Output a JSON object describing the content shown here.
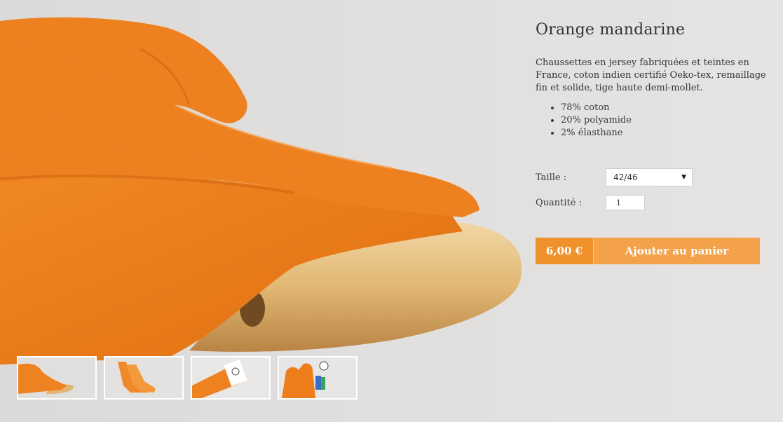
{
  "product": {
    "title": "Orange mandarine",
    "description": "Chaussettes en jersey fabriquées et teintes en France, coton indien certifié Oeko-tex,  remaillage  fin et solide, tige haute demi-mollet.",
    "composition": [
      "78% coton",
      "20% polyamide",
      "2% élasthane"
    ]
  },
  "options": {
    "size_label": "Taille  :",
    "size_value": "42/46",
    "quantity_label": "Quantité :",
    "quantity_value": "1"
  },
  "purchase": {
    "price": "6,00 €",
    "add_to_cart_label": "Ajouter au panier"
  },
  "gallery": {
    "thumbnails": [
      "socks-on-shoe-tree",
      "socks-on-legs",
      "socks-with-label",
      "socks-pile"
    ]
  },
  "colors": {
    "accent": "#f0922b",
    "accent_light": "#f3a24a",
    "sock_orange": "#ee7d1c"
  }
}
